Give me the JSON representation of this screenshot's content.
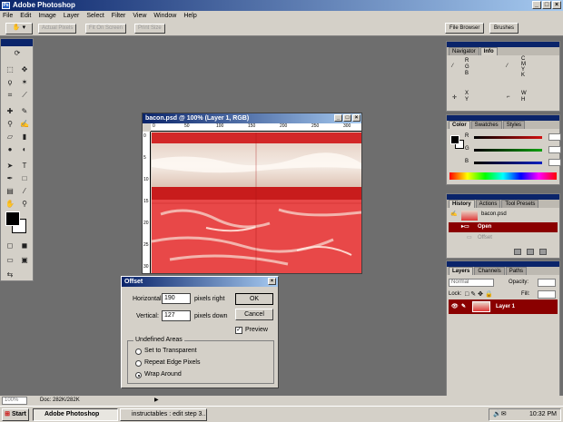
{
  "app": {
    "title": "Adobe Photoshop"
  },
  "menu": [
    "File",
    "Edit",
    "Image",
    "Layer",
    "Select",
    "Filter",
    "View",
    "Window",
    "Help"
  ],
  "options_bar": {
    "buttons": [
      "Actual Pixels",
      "Fit On Screen",
      "Print Size"
    ],
    "palette_well": [
      "File Browser",
      "Brushes"
    ]
  },
  "document": {
    "title": "bacon.psd @ 100% (Layer 1, RGB)",
    "ruler_h": [
      "0",
      "50",
      "100",
      "150",
      "200",
      "250",
      "300"
    ],
    "ruler_v": [
      "0",
      "5",
      "10",
      "15",
      "20",
      "25",
      "30"
    ]
  },
  "offset_dialog": {
    "title": "Offset",
    "horizontal_label": "Horizontal:",
    "horizontal_value": "190",
    "horizontal_unit": "pixels right",
    "vertical_label": "Vertical:",
    "vertical_value": "127",
    "vertical_unit": "pixels down",
    "ok_label": "OK",
    "cancel_label": "Cancel",
    "preview_label": "Preview",
    "undefined_areas_label": "Undefined Areas",
    "options": [
      "Set to Transparent",
      "Repeat Edge Pixels",
      "Wrap Around"
    ],
    "selected_option": "Wrap Around"
  },
  "navigator_panel": {
    "tabs": [
      "Navigator",
      "Info"
    ],
    "info": {
      "rgb": [
        "R",
        "G",
        "B"
      ],
      "cmyk": [
        "C",
        "M",
        "Y",
        "K"
      ],
      "xy": [
        "X",
        "Y"
      ],
      "wh": [
        "W",
        "H"
      ]
    }
  },
  "color_panel": {
    "tabs": [
      "Color",
      "Swatches",
      "Styles"
    ],
    "channels": [
      "R",
      "G",
      "B"
    ],
    "colors": {
      "r": "#d01010",
      "g": "#10a010",
      "b": "#1020c0"
    }
  },
  "history_panel": {
    "tabs": [
      "History",
      "Actions",
      "Tool Presets"
    ],
    "snapshot": "bacon.psd",
    "items": [
      "Open",
      "Offset"
    ]
  },
  "layers_panel": {
    "tabs": [
      "Layers",
      "Channels",
      "Paths"
    ],
    "blend_mode": "Normal",
    "opacity_label": "Opacity:",
    "lock_label": "Lock:",
    "fill_label": "Fill:",
    "layer_name": "Layer 1"
  },
  "status": {
    "zoom": "100%",
    "doc_info": "Doc: 282K/282K"
  },
  "taskbar": {
    "start_label": "Start",
    "tasks": [
      "Adobe Photoshop",
      "instructables : edit step 3..."
    ],
    "clock": "10:32 PM"
  },
  "accent_colors": {
    "titlebar": "#0a246a",
    "selected_row": "#8a0000"
  },
  "icons": [
    "move-icon",
    "marquee-icon",
    "lasso-icon",
    "magic-wand-icon",
    "crop-icon",
    "slice-icon",
    "brush-icon",
    "stamp-icon",
    "eraser-icon",
    "gradient-icon",
    "blur-icon",
    "dodge-icon",
    "path-icon",
    "type-icon",
    "pen-icon",
    "shape-icon",
    "notes-icon",
    "eyedropper-icon",
    "hand-icon",
    "zoom-icon"
  ]
}
